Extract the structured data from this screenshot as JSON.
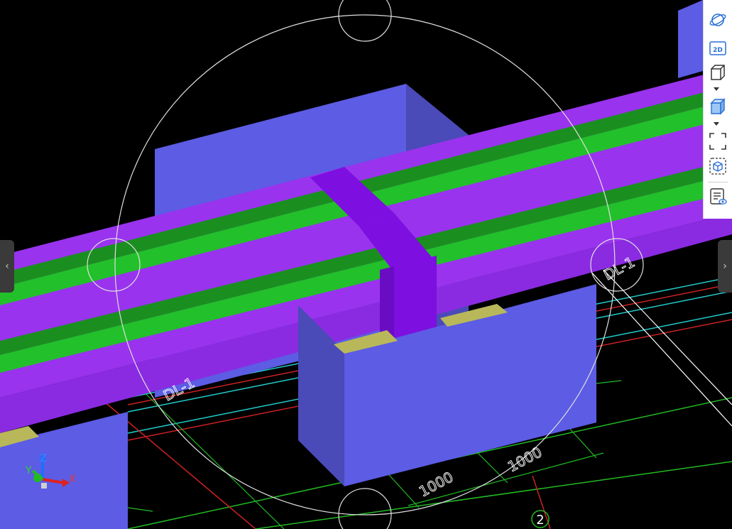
{
  "viewport": {
    "background": "#000000",
    "beam_label": "DL-1",
    "dimension_labels": [
      "1000",
      "1000"
    ],
    "grid_axis_label": "2",
    "axis_labels": {
      "x": "X",
      "y": "Y",
      "z": "Z"
    },
    "colors": {
      "beam": "#9933ee",
      "beam_top": "#8a2be2",
      "plate": "#22c02a",
      "plate_dark": "#1a8f20",
      "footing": "#5c5ce4",
      "footing_side": "#4a4ab8",
      "column": "#7d0fe0",
      "pad": "#b8b85a",
      "gridline_green": "#22bb22",
      "gridline_red": "#cc2222",
      "gridline_cyan": "#22cccc",
      "navcircle": "#e0e0e0"
    }
  },
  "toolbar": {
    "items": [
      {
        "icon": "orbit-icon"
      },
      {
        "icon": "view-2d-icon",
        "label": "2D"
      },
      {
        "icon": "wireframe-cube-icon"
      },
      {
        "icon": "shaded-cube-icon"
      },
      {
        "icon": "zoom-extents-icon"
      },
      {
        "icon": "local-3d-icon"
      },
      {
        "icon": "display-settings-icon"
      }
    ]
  },
  "side_tabs": {
    "left": "‹",
    "right": "›"
  }
}
